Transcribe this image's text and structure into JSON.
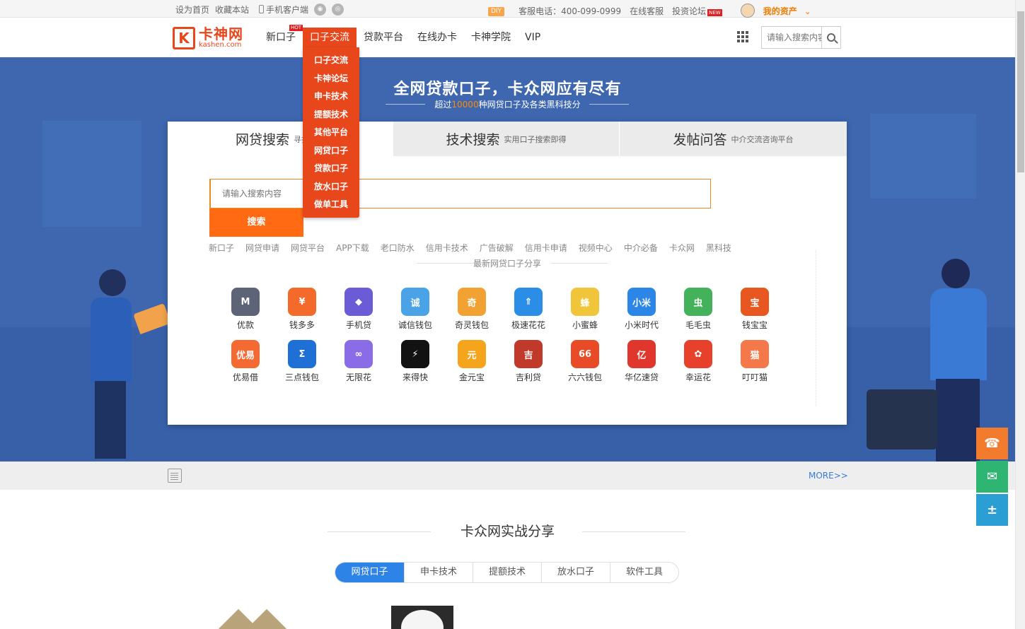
{
  "topbar": {
    "set_home": "设为首页",
    "bookmark": "收藏本站",
    "mobile_client": "手机客户端",
    "diy": "DIY",
    "hotline": "客服电话：400-099-0999",
    "online_service": "在线客服",
    "forum": "投资论坛",
    "new_badge": "NEW",
    "my_assets": "我的资产"
  },
  "logo": {
    "cn": "卡神网",
    "en": "kashen.com",
    "mark": "K"
  },
  "nav": {
    "items": [
      {
        "label": "新口子",
        "badge": "HOT"
      },
      {
        "label": "口子交流"
      },
      {
        "label": "贷款平台"
      },
      {
        "label": "在线办卡"
      },
      {
        "label": "卡神学院"
      },
      {
        "label": "VIP"
      }
    ],
    "search_placeholder": "请输入搜索内容"
  },
  "dropdown": [
    "口子交流",
    "卡神论坛",
    "申卡技术",
    "提额技术",
    "其他平台",
    "网贷口子",
    "贷款口子",
    "放水口子",
    "做单工具"
  ],
  "banner": {
    "title": "全网贷款口子，卡众网应有尽有",
    "sub_prefix": "超过",
    "sub_num": "10000",
    "sub_suffix": "种网贷口子及各类黑科技分"
  },
  "tabs": [
    {
      "title": "网贷搜索",
      "sub": "寻找你要"
    },
    {
      "title": "技术搜索",
      "sub": "实用口子搜索即得"
    },
    {
      "title": "发帖问答",
      "sub": "中介交流咨询平台"
    }
  ],
  "search": {
    "placeholder": "请输入搜索内容",
    "button": "搜索"
  },
  "keywords": [
    "新口子",
    "网贷申请",
    "网贷平台",
    "APP下载",
    "老口防水",
    "信用卡技术",
    "广告破解",
    "信用卡申请",
    "视频中心",
    "中介必备",
    "卡众网",
    "黑科技"
  ],
  "latest_title": "最新网贷口子分享",
  "apps": [
    {
      "name": "优款",
      "glyph": "M",
      "color": "#5d6478"
    },
    {
      "name": "钱多多",
      "glyph": "¥",
      "color": "#f36a2a"
    },
    {
      "name": "手机贷",
      "glyph": "◆",
      "color": "#6b5bd6"
    },
    {
      "name": "诚信钱包",
      "glyph": "诚",
      "color": "#4aa3e6"
    },
    {
      "name": "奇灵钱包",
      "glyph": "奇",
      "color": "#f1a233"
    },
    {
      "name": "极速花花",
      "glyph": "⇑",
      "color": "#2b8ee6"
    },
    {
      "name": "小蜜蜂",
      "glyph": "蜂",
      "color": "#f1c53a"
    },
    {
      "name": "小米时代",
      "glyph": "小米",
      "color": "#2b86e8"
    },
    {
      "name": "毛毛虫",
      "glyph": "虫",
      "color": "#43b25a"
    },
    {
      "name": "钱宝宝",
      "glyph": "宝",
      "color": "#e8571f"
    },
    {
      "name": "优易借",
      "glyph": "优易",
      "color": "#f56a33"
    },
    {
      "name": "三点钱包",
      "glyph": "Σ",
      "color": "#1e6fd6"
    },
    {
      "name": "无限花",
      "glyph": "∞",
      "color": "#8a6ce6"
    },
    {
      "name": "来得快",
      "glyph": "⚡",
      "color": "#121212"
    },
    {
      "name": "金元宝",
      "glyph": "元",
      "color": "#f5a51c"
    },
    {
      "name": "吉利贷",
      "glyph": "吉",
      "color": "#c0392b"
    },
    {
      "name": "六六钱包",
      "glyph": "66",
      "color": "#e94b26"
    },
    {
      "name": "华亿速贷",
      "glyph": "亿",
      "color": "#e0362c"
    },
    {
      "name": "幸运花",
      "glyph": "✿",
      "color": "#e8412b"
    },
    {
      "name": "叮叮猫",
      "glyph": "猫",
      "color": "#f5784a"
    }
  ],
  "newsbar": {
    "more": "MORE>>"
  },
  "section": {
    "title": "卡众网实战分享",
    "pills": [
      "网贷口子",
      "申卡技术",
      "提额技术",
      "放水口子",
      "软件工具"
    ]
  },
  "side_tools": [
    {
      "name": "customer-service",
      "glyph": "☎",
      "color": "#f27b2e"
    },
    {
      "name": "wechat",
      "glyph": "✉",
      "color": "#2fb572"
    },
    {
      "name": "calculator",
      "glyph": "±",
      "color": "#2b9fd3"
    }
  ]
}
